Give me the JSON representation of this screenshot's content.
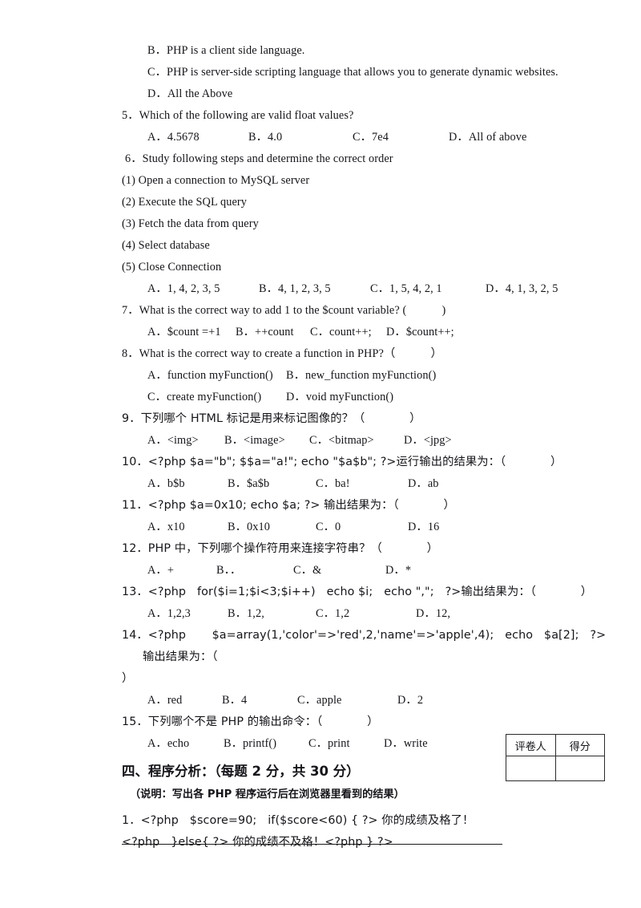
{
  "document": {
    "type": "exam-paper",
    "language": "mixed-en-zh"
  },
  "questions": [
    {
      "id": "q4-cont",
      "number": "",
      "stem": "",
      "options": [
        "B．PHP is a client side language.",
        "C．PHP is server-side scripting language that allows you to generate dynamic websites.",
        "D．All the Above"
      ]
    },
    {
      "id": "q5",
      "number": "5．",
      "stem": "Which of the following are valid float values?",
      "options": [
        "A．4.5678",
        "B．4.0",
        "C．7e4",
        "D．All of above"
      ]
    },
    {
      "id": "q6",
      "number": "6．",
      "stem": "Study following steps and determine the correct order",
      "steps": [
        "(1) Open a connection to MySQL server",
        "(2) Execute the SQL query",
        "(3) Fetch the data from query",
        "(4) Select database",
        "(5) Close Connection"
      ],
      "options": [
        "A．1, 4, 2, 3, 5",
        "B．4, 1, 2, 3, 5",
        "C．1, 5, 4, 2, 1",
        "D．4, 1, 3, 2, 5"
      ]
    },
    {
      "id": "q7",
      "number": "7．",
      "stem": "What is the correct way to add 1 to the $count variable? (            )",
      "options": [
        "A．$count =+1",
        "B．++count",
        "C．count++;",
        "D．$count++;"
      ]
    },
    {
      "id": "q8",
      "number": "8．",
      "stem": "What is the correct way to create a function in PHP?（            ）",
      "options_row1": [
        "A．function myFunction()",
        "B．new_function myFunction()"
      ],
      "options_row2": [
        "C．create myFunction()",
        "D．void myFunction()"
      ]
    },
    {
      "id": "q9",
      "number": "9．",
      "stem": "下列哪个 HTML 标记是用来标记图像的？（            ）",
      "options": [
        "A．<img>",
        "B．<image>",
        "C．<bitmap>",
        "D．<jpg>"
      ]
    },
    {
      "id": "q10",
      "number": "10．",
      "stem": "<?php $a=\"b\"; $$a=\"a!\"; echo \"$a$b\"; ?>运行输出的结果为：（            ）",
      "options": [
        "A．b$b",
        "B．$a$b",
        "C．ba!",
        "D．ab"
      ]
    },
    {
      "id": "q11",
      "number": "11．",
      "stem": "<?php $a=0x10; echo $a; ?> 输出结果为：（            ）",
      "options": [
        "A．x10",
        "B．0x10",
        "C．0",
        "D．16"
      ]
    },
    {
      "id": "q12",
      "number": "12．",
      "stem": "PHP 中，下列哪个操作符用来连接字符串？（            ）",
      "options": [
        "A．+",
        "B．．",
        "C．&",
        "D．*"
      ]
    },
    {
      "id": "q13",
      "number": "13．",
      "stem": "<?php   for($i=1;$i<3;$i++)   echo $i;   echo \",\";   ?>输出结果为：（            ）",
      "options": [
        "A．1,2,3",
        "B．1,2,",
        "C．1,2",
        "D．12,"
      ]
    },
    {
      "id": "q14",
      "number": "14．",
      "stem": "<?php       $a=array(1,'color'=>'red',2,'name'=>'apple',4);   echo   $a[2];   ?>输出结果为：（",
      "stem_wrap": "）",
      "options": [
        "A．red",
        "B．4",
        "C．apple",
        "D．2"
      ]
    },
    {
      "id": "q15",
      "number": "15．",
      "stem": "下列哪个不是 PHP 的输出命令：（            ）",
      "options": [
        "A．echo",
        "B．printf()",
        "C．print",
        "D．write"
      ]
    }
  ],
  "section4": {
    "heading": "四、程序分析：（每题 2 分，共 30 分）",
    "note": "（说明：写出各 PHP 程序运行后在浏览器里看到的结果）",
    "score_table": {
      "headers": [
        "评卷人",
        "得分"
      ],
      "values": [
        "",
        ""
      ]
    },
    "items": [
      {
        "number": "1．",
        "line1": "<?php   $score=90;   if($score<60) { ?> 你的成绩及格了！",
        "line2": "<?php   }else{ ?> 你的成绩不及格！<?php } ?>"
      }
    ]
  }
}
